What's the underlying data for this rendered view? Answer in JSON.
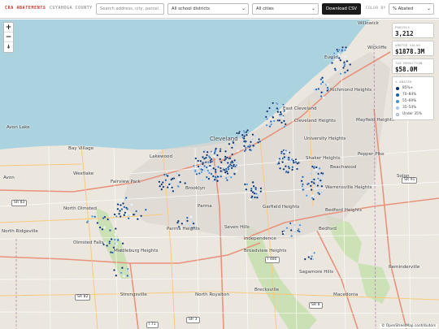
{
  "toolbar": {
    "brand": "CRA ABATEMENTS",
    "separator": "/",
    "county": "CUYAHOGA COUNTY",
    "search_placeholder": "Search address, city, parcel...",
    "district_select": "All school districts",
    "city_select": "All cities",
    "download_label": "Download CSV",
    "color_by_label": "COLOR BY",
    "color_by_value": "% Abated"
  },
  "zoom": {
    "in": "+",
    "out": "−",
    "reset": "⍋"
  },
  "stats": [
    {
      "label": "PARCELS",
      "value": "3,212"
    },
    {
      "label": "ABATED VALUE",
      "value": "$1878.3M"
    },
    {
      "label": "TAX REDUCTION",
      "value": "$58.0M"
    }
  ],
  "legend": {
    "title": "% ABATED",
    "items": [
      {
        "label": "85%+",
        "color": "#08306b"
      },
      {
        "label": "70–84%",
        "color": "#1f5fa8"
      },
      {
        "label": "55–69%",
        "color": "#4f8fcb"
      },
      {
        "label": "35–54%",
        "color": "#a6c8e8"
      },
      {
        "label": "Under 35%",
        "color": "#e4eef8"
      }
    ]
  },
  "attribution": "© OpenStreetMap contributors",
  "map_labels": [
    "Willowick",
    "Euclid",
    "Wickliffe",
    "Richmond Heights",
    "East Cleveland",
    "Cleveland Heights",
    "Mayfield Heights",
    "University Heights",
    "Shaker Heights",
    "Pepper Pike",
    "Beachwood",
    "Cleveland",
    "Avon Lake",
    "Bay Village",
    "Westlake",
    "Fairview Park",
    "Lakewood",
    "Avon",
    "Brooklyn",
    "North Olmsted",
    "Parma",
    "Parma Heights",
    "Garfield Heights",
    "Bedford Heights",
    "Warrensville Heights",
    "North Ridgeville",
    "Olmsted Falls",
    "Seven Hills",
    "Independence",
    "Bedford",
    "Middleburg Heights",
    "Broadview Heights",
    "Sagamore Hills",
    "Strongsville",
    "North Royalton",
    "Brecksville",
    "Reminderville",
    "Macedonia",
    "Solon"
  ],
  "road_shields": [
    "SR 83",
    "SR 91",
    "SR 82",
    "I 71",
    "SR 3",
    "I 480",
    "SR 8"
  ]
}
